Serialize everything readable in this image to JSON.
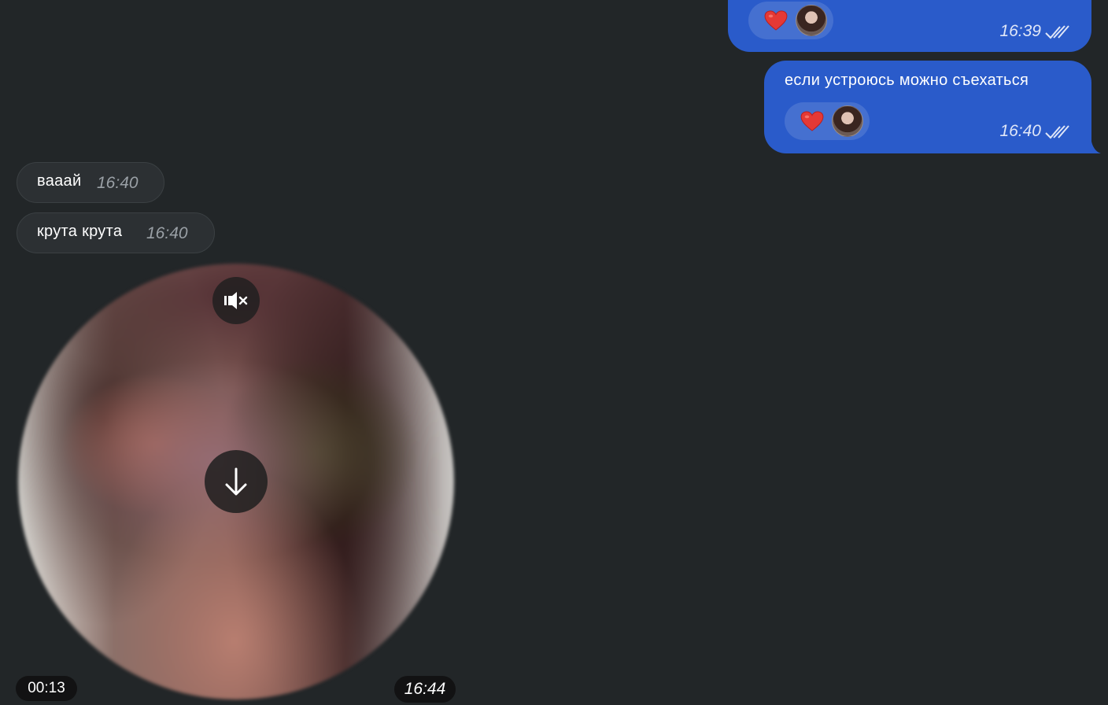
{
  "outgoing": [
    {
      "text": "",
      "time": "16:39",
      "reaction": "heart-icon"
    },
    {
      "text": "если устроюсь можно съехаться",
      "time": "16:40",
      "reaction": "heart-icon"
    }
  ],
  "incoming": [
    {
      "text": "вааай",
      "time": "16:40"
    },
    {
      "text": "крута крута",
      "time": "16:40"
    }
  ],
  "video_message": {
    "duration": "00:13",
    "time": "16:44"
  },
  "colors": {
    "background": "#222628",
    "outgoing_bubble": "#2a5bca",
    "incoming_bubble": "#2c3033",
    "heart": "#e53935"
  }
}
